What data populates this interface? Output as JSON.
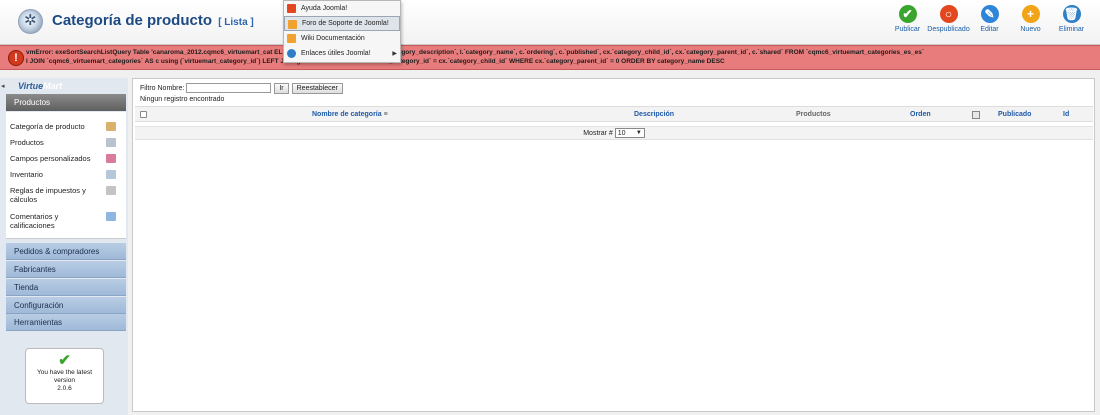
{
  "header": {
    "title": "Categoría de producto",
    "subtitle": "[ Lista ]"
  },
  "toolbar": [
    {
      "label": "Publicar",
      "icon": "check-icon",
      "color": "#3aa52c",
      "glyph": "✔"
    },
    {
      "label": "Despublicado",
      "icon": "unpublish-icon",
      "color": "#e2471f",
      "glyph": "○"
    },
    {
      "label": "Editar",
      "icon": "edit-icon",
      "color": "#2f86d8",
      "glyph": "✎"
    },
    {
      "label": "Nuevo",
      "icon": "new-icon",
      "color": "#f2a418",
      "glyph": "+"
    },
    {
      "label": "Eliminar",
      "icon": "trash-icon",
      "color": "#2f7fc8",
      "glyph": "🗑"
    }
  ],
  "dropdown": {
    "items": [
      {
        "label": "Ayuda Joomla!",
        "icon": "joomla-icon",
        "color": "#e2471f"
      },
      {
        "label": "Foro de Soporte de Joomla!",
        "icon": "forum-icon",
        "color": "#f0a12e"
      },
      {
        "label": "Wiki Documentación",
        "icon": "wiki-icon",
        "color": "#f0a12e"
      },
      {
        "label": "Enlaces útiles Joomla!",
        "icon": "links-icon",
        "color": "#2f7fc8"
      }
    ]
  },
  "error": {
    "line1": "vmError: exeSortSearchListQuery Table 'canaroma_2012.cqmc6_virtuemart_cat                                        ELECT c.`virtuemart_category_id`, l.`category_description`, l.`category_name`, c.`ordering`, c.`published`, cx.`category_child_id`, cx.`category_parent_id`, c.`shared` FROM `cqmc6_virtuemart_categories_es_es`",
    "line2": "l JOIN `cqmc6_virtuemart_categories` AS c using (`virtuemart_category_id`) LEFT JO                                   tegories` AS cx ON l.`virtuemart_category_id` = cx.`category_child_id` WHERE cx.`category_parent_id` = 0 ORDER BY category_name DESC"
  },
  "sidebar": {
    "logo_part1": "Virtue",
    "logo_part2": "Mart",
    "active_section": "Productos",
    "product_items": [
      {
        "label": "Categoría de producto",
        "icon": "category-icon",
        "color": "#d9b16a"
      },
      {
        "label": "Productos",
        "icon": "products-icon",
        "color": "#b9c3cf"
      },
      {
        "label": "Campos personalizados",
        "icon": "custom-fields-icon",
        "color": "#d97b9b"
      },
      {
        "label": "Inventario",
        "icon": "inventory-icon",
        "color": "#b7c7da"
      },
      {
        "label": "Reglas de impuestos y cálculos",
        "icon": "tax-icon",
        "color": "#c4c4c4"
      },
      {
        "label": "Comentarios y calificaciones",
        "icon": "comments-icon",
        "color": "#8fb6e0"
      }
    ],
    "sections": [
      "Pedidos & compradores",
      "Fabricantes",
      "Tienda",
      "Configuración",
      "Herramientas"
    ],
    "version": {
      "line1": "You have the latest",
      "line2": "version",
      "line3": "2.0.6"
    }
  },
  "filter": {
    "label": "Filtro Nombre:",
    "value": "",
    "go_label": "Ir",
    "reset_label": "Reestablecer"
  },
  "table": {
    "no_records": "Ningun registro encontrado",
    "headers": {
      "name": "Nombre de categoría",
      "description": "Descripción",
      "products": "Productos",
      "order": "Orden",
      "published": "Publicado",
      "id": "Id"
    },
    "show_label": "Mostrar #",
    "show_value": "10"
  }
}
